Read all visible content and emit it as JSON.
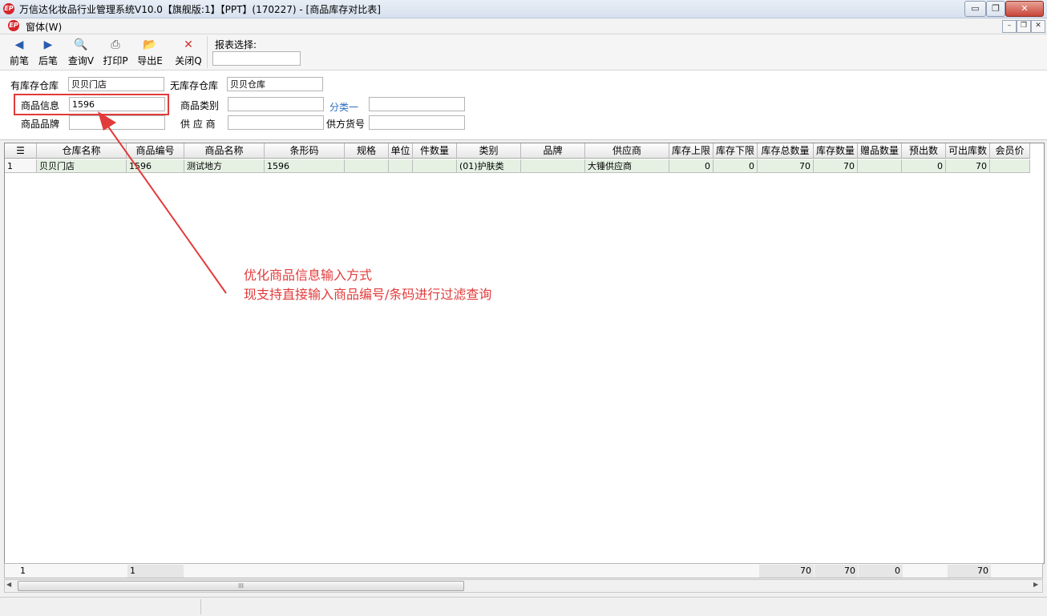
{
  "window": {
    "title": "万信达化妆品行业管理系统V10.0【旗舰版:1】【PPT】(170227) - [商品库存对比表]",
    "app_icon": "EP",
    "minimize": "▭",
    "restore": "❐",
    "close": "✕"
  },
  "menubar": {
    "window_menu": "窗体(W)",
    "mdi_minimize": "–",
    "mdi_restore": "❐",
    "mdi_close": "✕"
  },
  "toolbar": {
    "prev": "前笔",
    "next": "后笔",
    "query": "查询V",
    "print": "打印P",
    "export": "导出E",
    "close": "关闭Q",
    "report_label": "报表选择:",
    "report_value": ""
  },
  "filter": {
    "stock_wh_label": "有库存仓库",
    "stock_wh_value": "贝贝门店",
    "nostock_wh_label": "无库存仓库",
    "nostock_wh_value": "贝贝仓库",
    "product_info_label": "商品信息",
    "product_info_value": "1596",
    "category_label": "商品类别",
    "category_value": "",
    "class1_label": "分类一",
    "class1_value": "",
    "brand_label": "商品品牌",
    "brand_value": "",
    "supplier_label": "供 应 商",
    "supplier_value": "",
    "supplier_code_label": "供方货号",
    "supplier_code_value": ""
  },
  "grid": {
    "corner": "☰",
    "columns": [
      "仓库名称",
      "商品编号",
      "商品名称",
      "条形码",
      "规格",
      "单位",
      "件数量",
      "类别",
      "品牌",
      "供应商",
      "库存上限",
      "库存下限",
      "库存总数量",
      "库存数量",
      "赠品数量",
      "预出数",
      "可出库数",
      "会员价"
    ],
    "rows": [
      [
        "1",
        "贝贝门店",
        "1596",
        "测试地方",
        "1596",
        "",
        "",
        "",
        "(01)护肤类",
        "",
        "大锤供应商",
        "0",
        "0",
        "70",
        "70",
        "",
        "0",
        "70",
        ""
      ]
    ]
  },
  "footer": {
    "row_count": "1",
    "product_count": "1",
    "total_qty": "70",
    "stock_qty": "70",
    "gift_qty": "0",
    "available_qty": "70"
  },
  "scroll": {
    "left": "◀",
    "right": "▶",
    "grip": "III"
  },
  "annotation": {
    "line1": "优化商品信息输入方式",
    "line2": "现支持直接输入商品编号/条码进行过滤查询",
    "color": "#e23b3b"
  }
}
